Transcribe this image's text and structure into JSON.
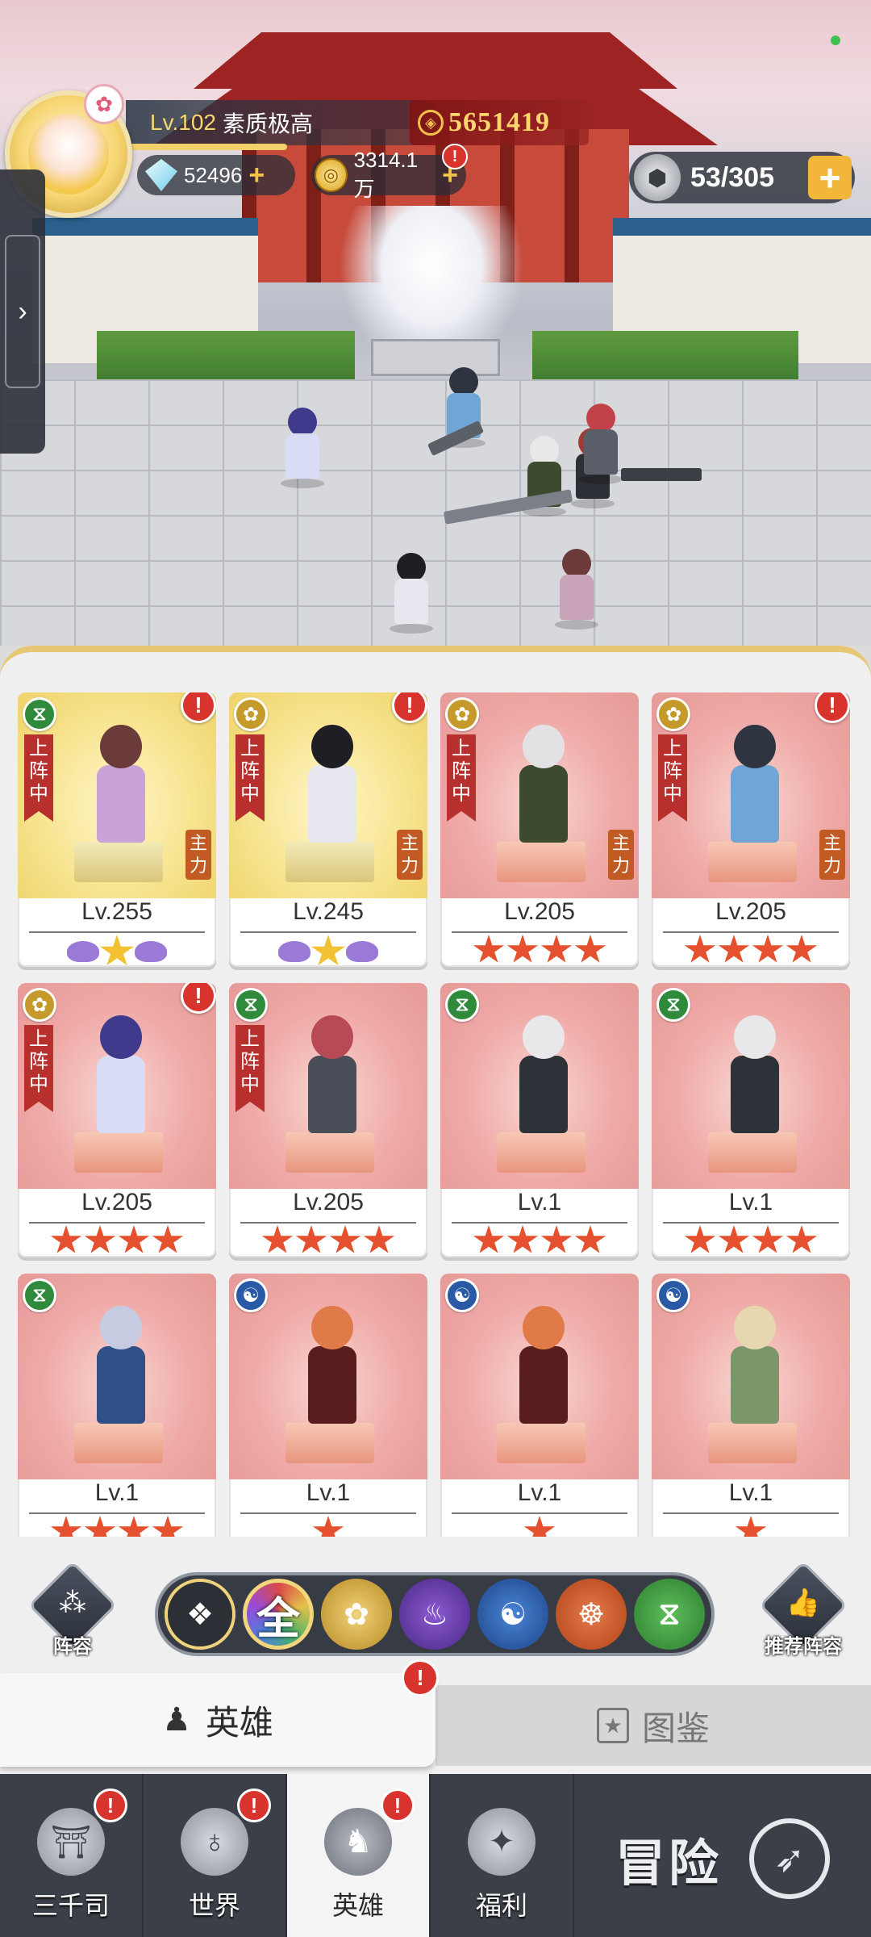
{
  "hud": {
    "level": "Lv.102",
    "player_name": "素质极高",
    "power": "5651419",
    "gems": "52496",
    "gold": "3314.1万",
    "stamina": "53/305"
  },
  "glyphs": {
    "plus": "+",
    "alert": "!",
    "chevron": "›",
    "power": "◈",
    "coin": "◎",
    "stamina": "⬢"
  },
  "heroes": [
    {
      "level": "Lv.255",
      "faction": "life",
      "deployed": "上阵中",
      "main": "主力",
      "bg": "gold",
      "alert": true,
      "rank": "gold",
      "stars": 0
    },
    {
      "level": "Lv.245",
      "faction": "lotus",
      "deployed": "上阵中",
      "main": "主力",
      "bg": "gold",
      "alert": true,
      "rank": "gold",
      "stars": 0
    },
    {
      "level": "Lv.205",
      "faction": "lotus",
      "deployed": "上阵中",
      "main": "主力",
      "bg": "red",
      "alert": false,
      "rank": "stars",
      "stars": 4
    },
    {
      "level": "Lv.205",
      "faction": "lotus",
      "deployed": "上阵中",
      "main": "主力",
      "bg": "red",
      "alert": true,
      "rank": "stars",
      "stars": 4
    },
    {
      "level": "Lv.205",
      "faction": "lotus",
      "deployed": "上阵中",
      "main": "",
      "bg": "red",
      "alert": true,
      "rank": "stars",
      "stars": 4
    },
    {
      "level": "Lv.205",
      "faction": "life",
      "deployed": "上阵中",
      "main": "",
      "bg": "red",
      "alert": false,
      "rank": "stars",
      "stars": 4
    },
    {
      "level": "Lv.1",
      "faction": "life",
      "deployed": "",
      "main": "",
      "bg": "red",
      "alert": false,
      "rank": "stars",
      "stars": 4
    },
    {
      "level": "Lv.1",
      "faction": "life",
      "deployed": "",
      "main": "",
      "bg": "red",
      "alert": false,
      "rank": "stars",
      "stars": 4
    },
    {
      "level": "Lv.1",
      "faction": "life",
      "deployed": "",
      "main": "",
      "bg": "red",
      "alert": false,
      "rank": "stars",
      "stars": 4
    },
    {
      "level": "Lv.1",
      "faction": "wind",
      "deployed": "",
      "main": "",
      "bg": "red",
      "alert": false,
      "rank": "stars",
      "stars": 1
    },
    {
      "level": "Lv.1",
      "faction": "wind",
      "deployed": "",
      "main": "",
      "bg": "red",
      "alert": false,
      "rank": "stars",
      "stars": 1
    },
    {
      "level": "Lv.1",
      "faction": "wind",
      "deployed": "",
      "main": "",
      "bg": "red",
      "alert": false,
      "rank": "stars",
      "stars": 1
    }
  ],
  "faction_colors": {
    "life": "#2f8a3c",
    "lotus": "#c59a2b",
    "wind": "#2a5aa6"
  },
  "filters": {
    "lineup_label": "阵容",
    "recommend_label": "推荐阵容",
    "all_label": "全",
    "buttons": [
      "cards",
      "all",
      "lotus",
      "shadow",
      "wind",
      "monk",
      "life"
    ],
    "selected": "all"
  },
  "tabs": {
    "heroes": "英雄",
    "codex": "图鉴"
  },
  "nav": {
    "items": [
      {
        "label": "三千司",
        "icon": "temple-icon",
        "alert": true
      },
      {
        "label": "世界",
        "icon": "planet-icon",
        "alert": true
      },
      {
        "label": "英雄",
        "icon": "hero-icon",
        "alert": true,
        "active": true
      },
      {
        "label": "福利",
        "icon": "gift-box-icon",
        "alert": false
      }
    ],
    "adventure": "冒险"
  }
}
